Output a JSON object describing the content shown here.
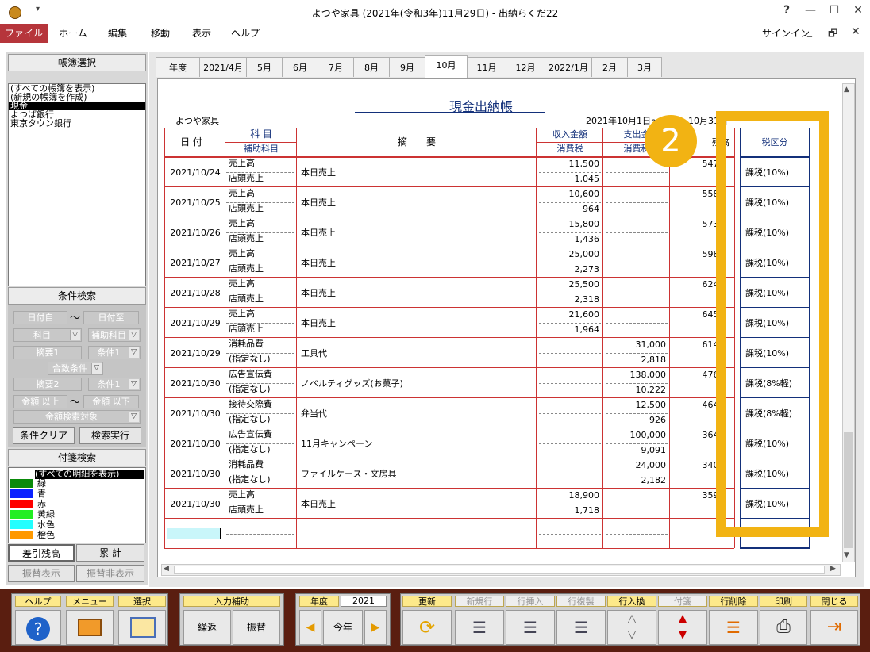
{
  "window": {
    "title": "よつや家具 (2021年(令和3年)11月29日) - 出納らくだ22",
    "help": "?",
    "minimize": "—",
    "maximize": "☐",
    "close": "✕"
  },
  "menubar": {
    "file": "ファイル",
    "items": [
      "ホーム",
      "編集",
      "移動",
      "表示",
      "ヘルプ"
    ],
    "signin": "サインイン",
    "restore": "🗗",
    "close": "✕",
    "min": "_"
  },
  "left_panel": {
    "book_select_title": "帳簿選択",
    "books": [
      "(すべての帳簿を表示)",
      "(新規の帳簿を作成)",
      "現金",
      "よつば銀行",
      "東京タウン銀行"
    ],
    "selected_book": "現金",
    "search_title": "条件検索",
    "date_from": "日付自",
    "tilde": "〜",
    "date_to": "日付至",
    "account": "科目",
    "sub_account": "補助科目",
    "summary1": "摘要1",
    "condition1": "条件1",
    "combine": "合致条件",
    "summary2": "摘要2",
    "condition2": "条件1",
    "amount_min": "金額 以上",
    "amount_max": "金額 以下",
    "amount_target": "金額検索対象",
    "clear_button": "条件クリア",
    "search_button": "検索実行",
    "sticky_title": "付箋検索",
    "sticky_all": "(すべての明細を表示)",
    "sticky_colors": [
      {
        "label": "緑",
        "color": "#0a8a0a"
      },
      {
        "label": "青",
        "color": "#0a22ff"
      },
      {
        "label": "赤",
        "color": "#ff0000"
      },
      {
        "label": "黄緑",
        "color": "#22ee22"
      },
      {
        "label": "水色",
        "color": "#22ffff"
      },
      {
        "label": "橙色",
        "color": "#ff9900"
      }
    ],
    "balance_button": "差引残高",
    "cumulative_button": "累 計",
    "transfer_show": "振替表示",
    "transfer_hide": "振替非表示"
  },
  "tabs": [
    "年度",
    "2021/4月",
    "5月",
    "6月",
    "7月",
    "8月",
    "9月",
    "10月",
    "11月",
    "12月",
    "2022/1月",
    "2月",
    "3月"
  ],
  "active_tab": "10月",
  "ledger": {
    "title": "現金出納帳",
    "company": "よつや家具",
    "period": "2021年10月1日～2021年10月31日",
    "period_visible": "2021年10月1日～",
    "period_end": "10月31日",
    "headers": {
      "date": "日 付",
      "account": "科 目",
      "sub_account": "補助科目",
      "summary": "摘　　要",
      "income": "収入金額",
      "tax1": "消費税",
      "expense": "支出金",
      "tax2": "消費税",
      "balance": "残高",
      "tax_category": "税区分"
    },
    "rows": [
      {
        "date": "2021/10/24",
        "account": "売上高",
        "sub": "店頭売上",
        "summary": "本日売上",
        "income": "11,500",
        "income_tax": "1,045",
        "expense": "",
        "expense_tax": "",
        "balance": "547,",
        "tax_cat": "課税(10%)"
      },
      {
        "date": "2021/10/25",
        "account": "売上高",
        "sub": "店頭売上",
        "summary": "本日売上",
        "income": "10,600",
        "income_tax": "964",
        "expense": "",
        "expense_tax": "",
        "balance": "558,",
        "tax_cat": "課税(10%)"
      },
      {
        "date": "2021/10/26",
        "account": "売上高",
        "sub": "店頭売上",
        "summary": "本日売上",
        "income": "15,800",
        "income_tax": "1,436",
        "expense": "",
        "expense_tax": "",
        "balance": "573,",
        "tax_cat": "課税(10%)"
      },
      {
        "date": "2021/10/27",
        "account": "売上高",
        "sub": "店頭売上",
        "summary": "本日売上",
        "income": "25,000",
        "income_tax": "2,273",
        "expense": "",
        "expense_tax": "",
        "balance": "598,",
        "tax_cat": "課税(10%)"
      },
      {
        "date": "2021/10/28",
        "account": "売上高",
        "sub": "店頭売上",
        "summary": "本日売上",
        "income": "25,500",
        "income_tax": "2,318",
        "expense": "",
        "expense_tax": "",
        "balance": "624,",
        "tax_cat": "課税(10%)"
      },
      {
        "date": "2021/10/29",
        "account": "売上高",
        "sub": "店頭売上",
        "summary": "本日売上",
        "income": "21,600",
        "income_tax": "1,964",
        "expense": "",
        "expense_tax": "",
        "balance": "645,",
        "tax_cat": "課税(10%)"
      },
      {
        "date": "2021/10/29",
        "account": "消耗品費",
        "sub": "(指定なし)",
        "summary": "工具代",
        "income": "",
        "income_tax": "",
        "expense": "31,000",
        "expense_tax": "2,818",
        "balance": "614,",
        "tax_cat": "課税(10%)"
      },
      {
        "date": "2021/10/30",
        "account": "広告宣伝費",
        "sub": "(指定なし)",
        "summary": "ノベルティグッズ(お菓子)",
        "income": "",
        "income_tax": "",
        "expense": "138,000",
        "expense_tax": "10,222",
        "balance": "476,",
        "tax_cat": "課税(8%軽)"
      },
      {
        "date": "2021/10/30",
        "account": "接待交際費",
        "sub": "(指定なし)",
        "summary": "弁当代",
        "income": "",
        "income_tax": "",
        "expense": "12,500",
        "expense_tax": "926",
        "balance": "464,",
        "tax_cat": "課税(8%軽)"
      },
      {
        "date": "2021/10/30",
        "account": "広告宣伝費",
        "sub": "(指定なし)",
        "summary": "11月キャンペーン",
        "income": "",
        "income_tax": "",
        "expense": "100,000",
        "expense_tax": "9,091",
        "balance": "364,",
        "tax_cat": "課税(10%)"
      },
      {
        "date": "2021/10/30",
        "account": "消耗品費",
        "sub": "(指定なし)",
        "summary": "ファイルケース・文房具",
        "income": "",
        "income_tax": "",
        "expense": "24,000",
        "expense_tax": "2,182",
        "balance": "340,",
        "tax_cat": "課税(10%)"
      },
      {
        "date": "2021/10/30",
        "account": "売上高",
        "sub": "店頭売上",
        "summary": "本日売上",
        "income": "18,900",
        "income_tax": "1,718",
        "expense": "",
        "expense_tax": "",
        "balance": "359,",
        "tax_cat": "課税(10%)"
      }
    ]
  },
  "callout": {
    "number": "2"
  },
  "toolbar": {
    "help": "ヘルプ",
    "menu": "メニュー",
    "select": "選択",
    "input_assist": "入力補助",
    "repeat": "繰返",
    "transfer": "振替",
    "year_label": "年度",
    "year_value": "2021",
    "this_year": "今年",
    "update": "更新",
    "new_row": "新規行",
    "insert_row": "行挿入",
    "copy_row": "行複製",
    "swap_row": "行入換",
    "sticky": "付箋",
    "delete_row": "行削除",
    "print": "印刷",
    "close": "閉じる"
  }
}
